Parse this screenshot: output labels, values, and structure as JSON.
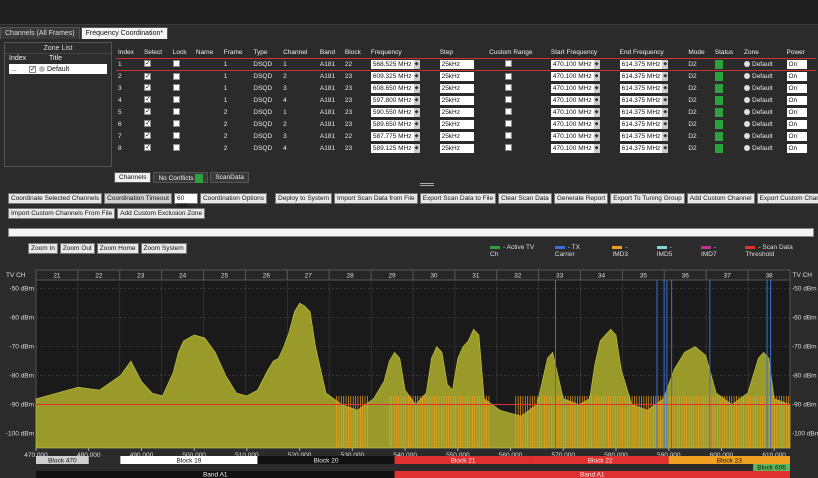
{
  "tabs": [
    {
      "label": "Channels (All Frames)"
    },
    {
      "label": "Frequency Coordination*"
    }
  ],
  "zone_list": {
    "title": "Zone List",
    "col_index": "Index",
    "col_title": "Title",
    "rows": [
      {
        "index": "...",
        "title": "Default"
      }
    ]
  },
  "table": {
    "headers": [
      "Index",
      "Select",
      "Lock",
      "Name",
      "Frame",
      "Type",
      "Channel",
      "Band",
      "Block",
      "Frequency",
      "Step",
      "Custom Range",
      "Start Frequency",
      "End Frequency",
      "Mode",
      "Status",
      "Zone",
      "Power"
    ],
    "rows": [
      {
        "index": "1",
        "select": true,
        "lock": false,
        "name": "",
        "frame": "1",
        "type": "DSQD",
        "channel": "1",
        "band": "A181",
        "block": "22",
        "frequency": "568.525 MHz",
        "step": "25kHz",
        "start": "470.100 MHz",
        "end": "614.375 MHz",
        "mode": "D2",
        "zone": "Default",
        "power": "On"
      },
      {
        "index": "2",
        "select": true,
        "lock": false,
        "name": "",
        "frame": "1",
        "type": "DSQD",
        "channel": "2",
        "band": "A181",
        "block": "23",
        "frequency": "609.325 MHz",
        "step": "25kHz",
        "start": "470.100 MHz",
        "end": "614.375 MHz",
        "mode": "D2",
        "zone": "Default",
        "power": "On"
      },
      {
        "index": "3",
        "select": true,
        "lock": false,
        "name": "",
        "frame": "1",
        "type": "DSQD",
        "channel": "3",
        "band": "A181",
        "block": "23",
        "frequency": "608.650 MHz",
        "step": "25kHz",
        "start": "470.100 MHz",
        "end": "614.375 MHz",
        "mode": "D2",
        "zone": "Default",
        "power": "On"
      },
      {
        "index": "4",
        "select": true,
        "lock": false,
        "name": "",
        "frame": "1",
        "type": "DSQD",
        "channel": "4",
        "band": "A181",
        "block": "23",
        "frequency": "597.800 MHz",
        "step": "25kHz",
        "start": "470.100 MHz",
        "end": "614.375 MHz",
        "mode": "D2",
        "zone": "Default",
        "power": "On"
      },
      {
        "index": "5",
        "select": true,
        "lock": false,
        "name": "",
        "frame": "2",
        "type": "DSQD",
        "channel": "1",
        "band": "A181",
        "block": "23",
        "frequency": "590.550 MHz",
        "step": "25kHz",
        "start": "470.100 MHz",
        "end": "614.375 MHz",
        "mode": "D2",
        "zone": "Default",
        "power": "On"
      },
      {
        "index": "6",
        "select": true,
        "lock": false,
        "name": "",
        "frame": "2",
        "type": "DSQD",
        "channel": "2",
        "band": "A181",
        "block": "23",
        "frequency": "589.650 MHz",
        "step": "25kHz",
        "start": "470.100 MHz",
        "end": "614.375 MHz",
        "mode": "D2",
        "zone": "Default",
        "power": "On"
      },
      {
        "index": "7",
        "select": true,
        "lock": false,
        "name": "",
        "frame": "2",
        "type": "DSQD",
        "channel": "3",
        "band": "A181",
        "block": "22",
        "frequency": "587.775 MHz",
        "step": "25kHz",
        "start": "470.100 MHz",
        "end": "614.375 MHz",
        "mode": "D2",
        "zone": "Default",
        "power": "On"
      },
      {
        "index": "8",
        "select": true,
        "lock": false,
        "name": "",
        "frame": "2",
        "type": "DSQD",
        "channel": "4",
        "band": "A181",
        "block": "23",
        "frequency": "589.125 MHz",
        "step": "25kHz",
        "start": "470.100 MHz",
        "end": "614.375 MHz",
        "mode": "D2",
        "zone": "Default",
        "power": "On"
      }
    ]
  },
  "subtabs": {
    "channels": "Channels",
    "no_conflicts": "No Conflicts",
    "scandata": "ScanData"
  },
  "buttons_row1": [
    "Coordinate Selected Channels",
    "Coordination Timeout",
    "Coordination Options",
    "Deploy to System",
    "Import Scan Data from File",
    "Export Scan Data to File",
    "Clear Scan Data",
    "Generate Report",
    "Export To Tuning Group",
    "Add Custom Channel",
    "Export Custom Channels To File"
  ],
  "timeout_value": "60 sec",
  "buttons_row2": [
    "Import Custom Channels From File",
    "Add Custom Exclusion Zone"
  ],
  "zoom_buttons": [
    "Zoom In",
    "Zoom Out",
    "Zoom Home",
    "Zoom System"
  ],
  "legend": [
    {
      "label": "Active TV Ch",
      "color": "#2e9e3f"
    },
    {
      "label": "TX Carrier",
      "color": "#3a6fd8"
    },
    {
      "label": "IMD3",
      "color": "#f0a020"
    },
    {
      "label": "IMD5",
      "color": "#7fd4d4"
    },
    {
      "label": "IMD7",
      "color": "#c03090"
    },
    {
      "label": "Scan Data Threshold",
      "color": "#e03030"
    }
  ],
  "chart_data": {
    "type": "area",
    "tv_label": "TV CH",
    "tv_channels": [
      "21",
      "22",
      "23",
      "24",
      "25",
      "26",
      "27",
      "28",
      "29",
      "30",
      "31",
      "32",
      "33",
      "34",
      "35",
      "36",
      "37",
      "38"
    ],
    "y_ticks": [
      "-50 dBm",
      "-60 dBm",
      "-70 dBm",
      "-80 dBm",
      "-90 dBm",
      "-100 dBm"
    ],
    "y_ticks_right": [
      "-50 dBm",
      "-60 dBm",
      "-70 dBm",
      "-80 dBm",
      "-90 dBm",
      "-100 dBm"
    ],
    "ylim": [
      -105,
      -47
    ],
    "x_ticks": [
      "470.000",
      "480.000",
      "490.000",
      "500.000",
      "510.000",
      "520.000",
      "530.000",
      "540.000",
      "550.000",
      "560.000",
      "570.000",
      "580.000",
      "590.000",
      "600.000",
      "610.000"
    ],
    "xlim": [
      470,
      613
    ],
    "threshold": -90,
    "scan": [
      [
        470,
        -88
      ],
      [
        474,
        -86
      ],
      [
        478,
        -84
      ],
      [
        482,
        -85
      ],
      [
        486,
        -80
      ],
      [
        488,
        -75
      ],
      [
        490,
        -82
      ],
      [
        492,
        -86
      ],
      [
        494,
        -87
      ],
      [
        496,
        -79
      ],
      [
        497,
        -72
      ],
      [
        498,
        -68
      ],
      [
        500,
        -66
      ],
      [
        502,
        -67
      ],
      [
        504,
        -72
      ],
      [
        506,
        -80
      ],
      [
        508,
        -86
      ],
      [
        510,
        -87
      ],
      [
        512,
        -85
      ],
      [
        514,
        -78
      ],
      [
        515,
        -75
      ],
      [
        516,
        -74
      ],
      [
        517,
        -70
      ],
      [
        518,
        -65
      ],
      [
        519,
        -58
      ],
      [
        520,
        -55
      ],
      [
        521,
        -56
      ],
      [
        522,
        -58
      ],
      [
        523,
        -70
      ],
      [
        525,
        -86
      ],
      [
        528,
        -90
      ],
      [
        531,
        -92
      ],
      [
        534,
        -88
      ],
      [
        536,
        -82
      ],
      [
        537,
        -75
      ],
      [
        538,
        -72
      ],
      [
        539,
        -74
      ],
      [
        540,
        -85
      ],
      [
        542,
        -90
      ],
      [
        544,
        -86
      ],
      [
        545,
        -74
      ],
      [
        546,
        -70
      ],
      [
        547,
        -72
      ],
      [
        548,
        -83
      ],
      [
        549,
        -85
      ],
      [
        550,
        -74
      ],
      [
        551,
        -70
      ],
      [
        552,
        -68
      ],
      [
        553,
        -64
      ],
      [
        554,
        -66
      ],
      [
        555,
        -88
      ],
      [
        558,
        -92
      ],
      [
        562,
        -94
      ],
      [
        565,
        -90
      ],
      [
        566,
        -82
      ],
      [
        567,
        -74
      ],
      [
        568,
        -72
      ],
      [
        569,
        -80
      ],
      [
        570,
        -88
      ],
      [
        573,
        -90
      ],
      [
        575,
        -88
      ],
      [
        576,
        -76
      ],
      [
        577,
        -68
      ],
      [
        578,
        -66
      ],
      [
        579,
        -64
      ],
      [
        580,
        -66
      ],
      [
        581,
        -78
      ],
      [
        583,
        -90
      ],
      [
        586,
        -92
      ],
      [
        589,
        -88
      ],
      [
        591,
        -78
      ],
      [
        593,
        -72
      ],
      [
        595,
        -70
      ],
      [
        597,
        -73
      ],
      [
        599,
        -86
      ],
      [
        602,
        -90
      ],
      [
        605,
        -86
      ],
      [
        607,
        -74
      ],
      [
        608,
        -72
      ],
      [
        609,
        -74
      ],
      [
        610,
        -88
      ],
      [
        613,
        -90
      ]
    ],
    "carriers": [
      568.525,
      609.325,
      608.65,
      597.8,
      590.55,
      589.65,
      587.775,
      589.125
    ],
    "carrier_level": -84,
    "imd3_spans": [
      [
        527,
        533
      ],
      [
        537,
        556
      ],
      [
        561,
        613
      ]
    ],
    "imd3_level": -87,
    "blocks_row1": [
      {
        "label": "Block 470",
        "from": 470,
        "to": 480,
        "color": "#cfcfcf"
      },
      {
        "label": "Block 19",
        "from": 486,
        "to": 512,
        "color": "#ffffff"
      },
      {
        "label": "Block 20",
        "from": 512,
        "to": 538,
        "color": "#111111"
      },
      {
        "label": "Block 21",
        "from": 538,
        "to": 564,
        "color": "#e03030"
      },
      {
        "label": "Block 22",
        "from": 564,
        "to": 590,
        "color": "#e03030"
      },
      {
        "label": "Block 23",
        "from": 590,
        "to": 613,
        "color": "#f0a020"
      }
    ],
    "blocks_row2": [
      {
        "label": "Block 606",
        "from": 606,
        "to": 613,
        "color": "#5cb85c"
      }
    ],
    "bands": [
      {
        "label": "Band A1",
        "from": 470,
        "to": 538,
        "color": "#111111"
      },
      {
        "label": "Band A1",
        "from": 538,
        "to": 613,
        "color": "#e03030"
      }
    ]
  }
}
